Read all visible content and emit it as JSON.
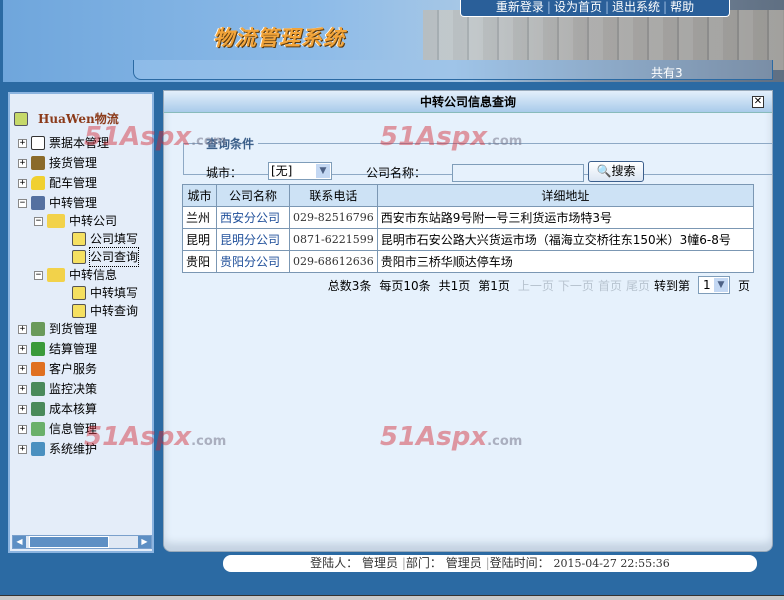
{
  "header": {
    "app_title": "物流管理系统",
    "online_text": "共有3",
    "top_menu": [
      "重新登录",
      "设为首页",
      "退出系统",
      "帮助"
    ]
  },
  "sidebar": {
    "root": "HuaWen物流",
    "items": [
      {
        "label": "票据本管理",
        "expanded": false
      },
      {
        "label": "接货管理",
        "expanded": false
      },
      {
        "label": "配车管理",
        "expanded": false
      },
      {
        "label": "中转管理",
        "expanded": true,
        "children": [
          {
            "label": "中转公司",
            "children": [
              {
                "label": "公司填写"
              },
              {
                "label": "公司查询",
                "selected": true
              }
            ]
          },
          {
            "label": "中转信息",
            "children": [
              {
                "label": "中转填写"
              },
              {
                "label": "中转查询"
              }
            ]
          }
        ]
      },
      {
        "label": "到货管理",
        "expanded": false
      },
      {
        "label": "结算管理",
        "expanded": false
      },
      {
        "label": "客户服务",
        "expanded": false
      },
      {
        "label": "监控决策",
        "expanded": false
      },
      {
        "label": "成本核算",
        "expanded": false
      },
      {
        "label": "信息管理",
        "expanded": false
      },
      {
        "label": "系统维护",
        "expanded": false
      }
    ]
  },
  "dialog": {
    "title": "中转公司信息查询",
    "close": "✕",
    "query": {
      "legend": "查询条件",
      "city_label": "城市：",
      "city_value": "[无]",
      "company_label": "公司名称：",
      "company_value": "",
      "search_button": "搜索"
    },
    "table": {
      "headers": [
        "城市",
        "公司名称",
        "联系电话",
        "详细地址"
      ],
      "rows": [
        [
          "兰州",
          "西安分公司",
          "029-82516796",
          "西安市东站路9号附一号三利货运市场特3号"
        ],
        [
          "昆明",
          "昆明分公司",
          "0871-6221599",
          "昆明市石安公路大兴货运市场（福海立交桥往东150米）3幢6-8号"
        ],
        [
          "贵阳",
          "贵阳分公司",
          "029-68612636",
          "贵阳市三桥华顺达停车场"
        ]
      ]
    },
    "pager": {
      "total": "总数3条",
      "per_page": "每页10条",
      "pages": "共1页",
      "current": "第1页",
      "prev": "上一页",
      "next": "下一页",
      "first": "首页",
      "last": "尾页",
      "goto": "转到第",
      "page_value": "1",
      "page_suffix": "页"
    }
  },
  "footer": {
    "user_label": "登陆人：",
    "user": "管理员",
    "dept_label": "部门：",
    "dept": "管理员",
    "time_label": "登陆时间：",
    "time": "2015-04-27 22:55:36"
  },
  "watermark": {
    "text": "51Aspx",
    ".com": ".com"
  }
}
